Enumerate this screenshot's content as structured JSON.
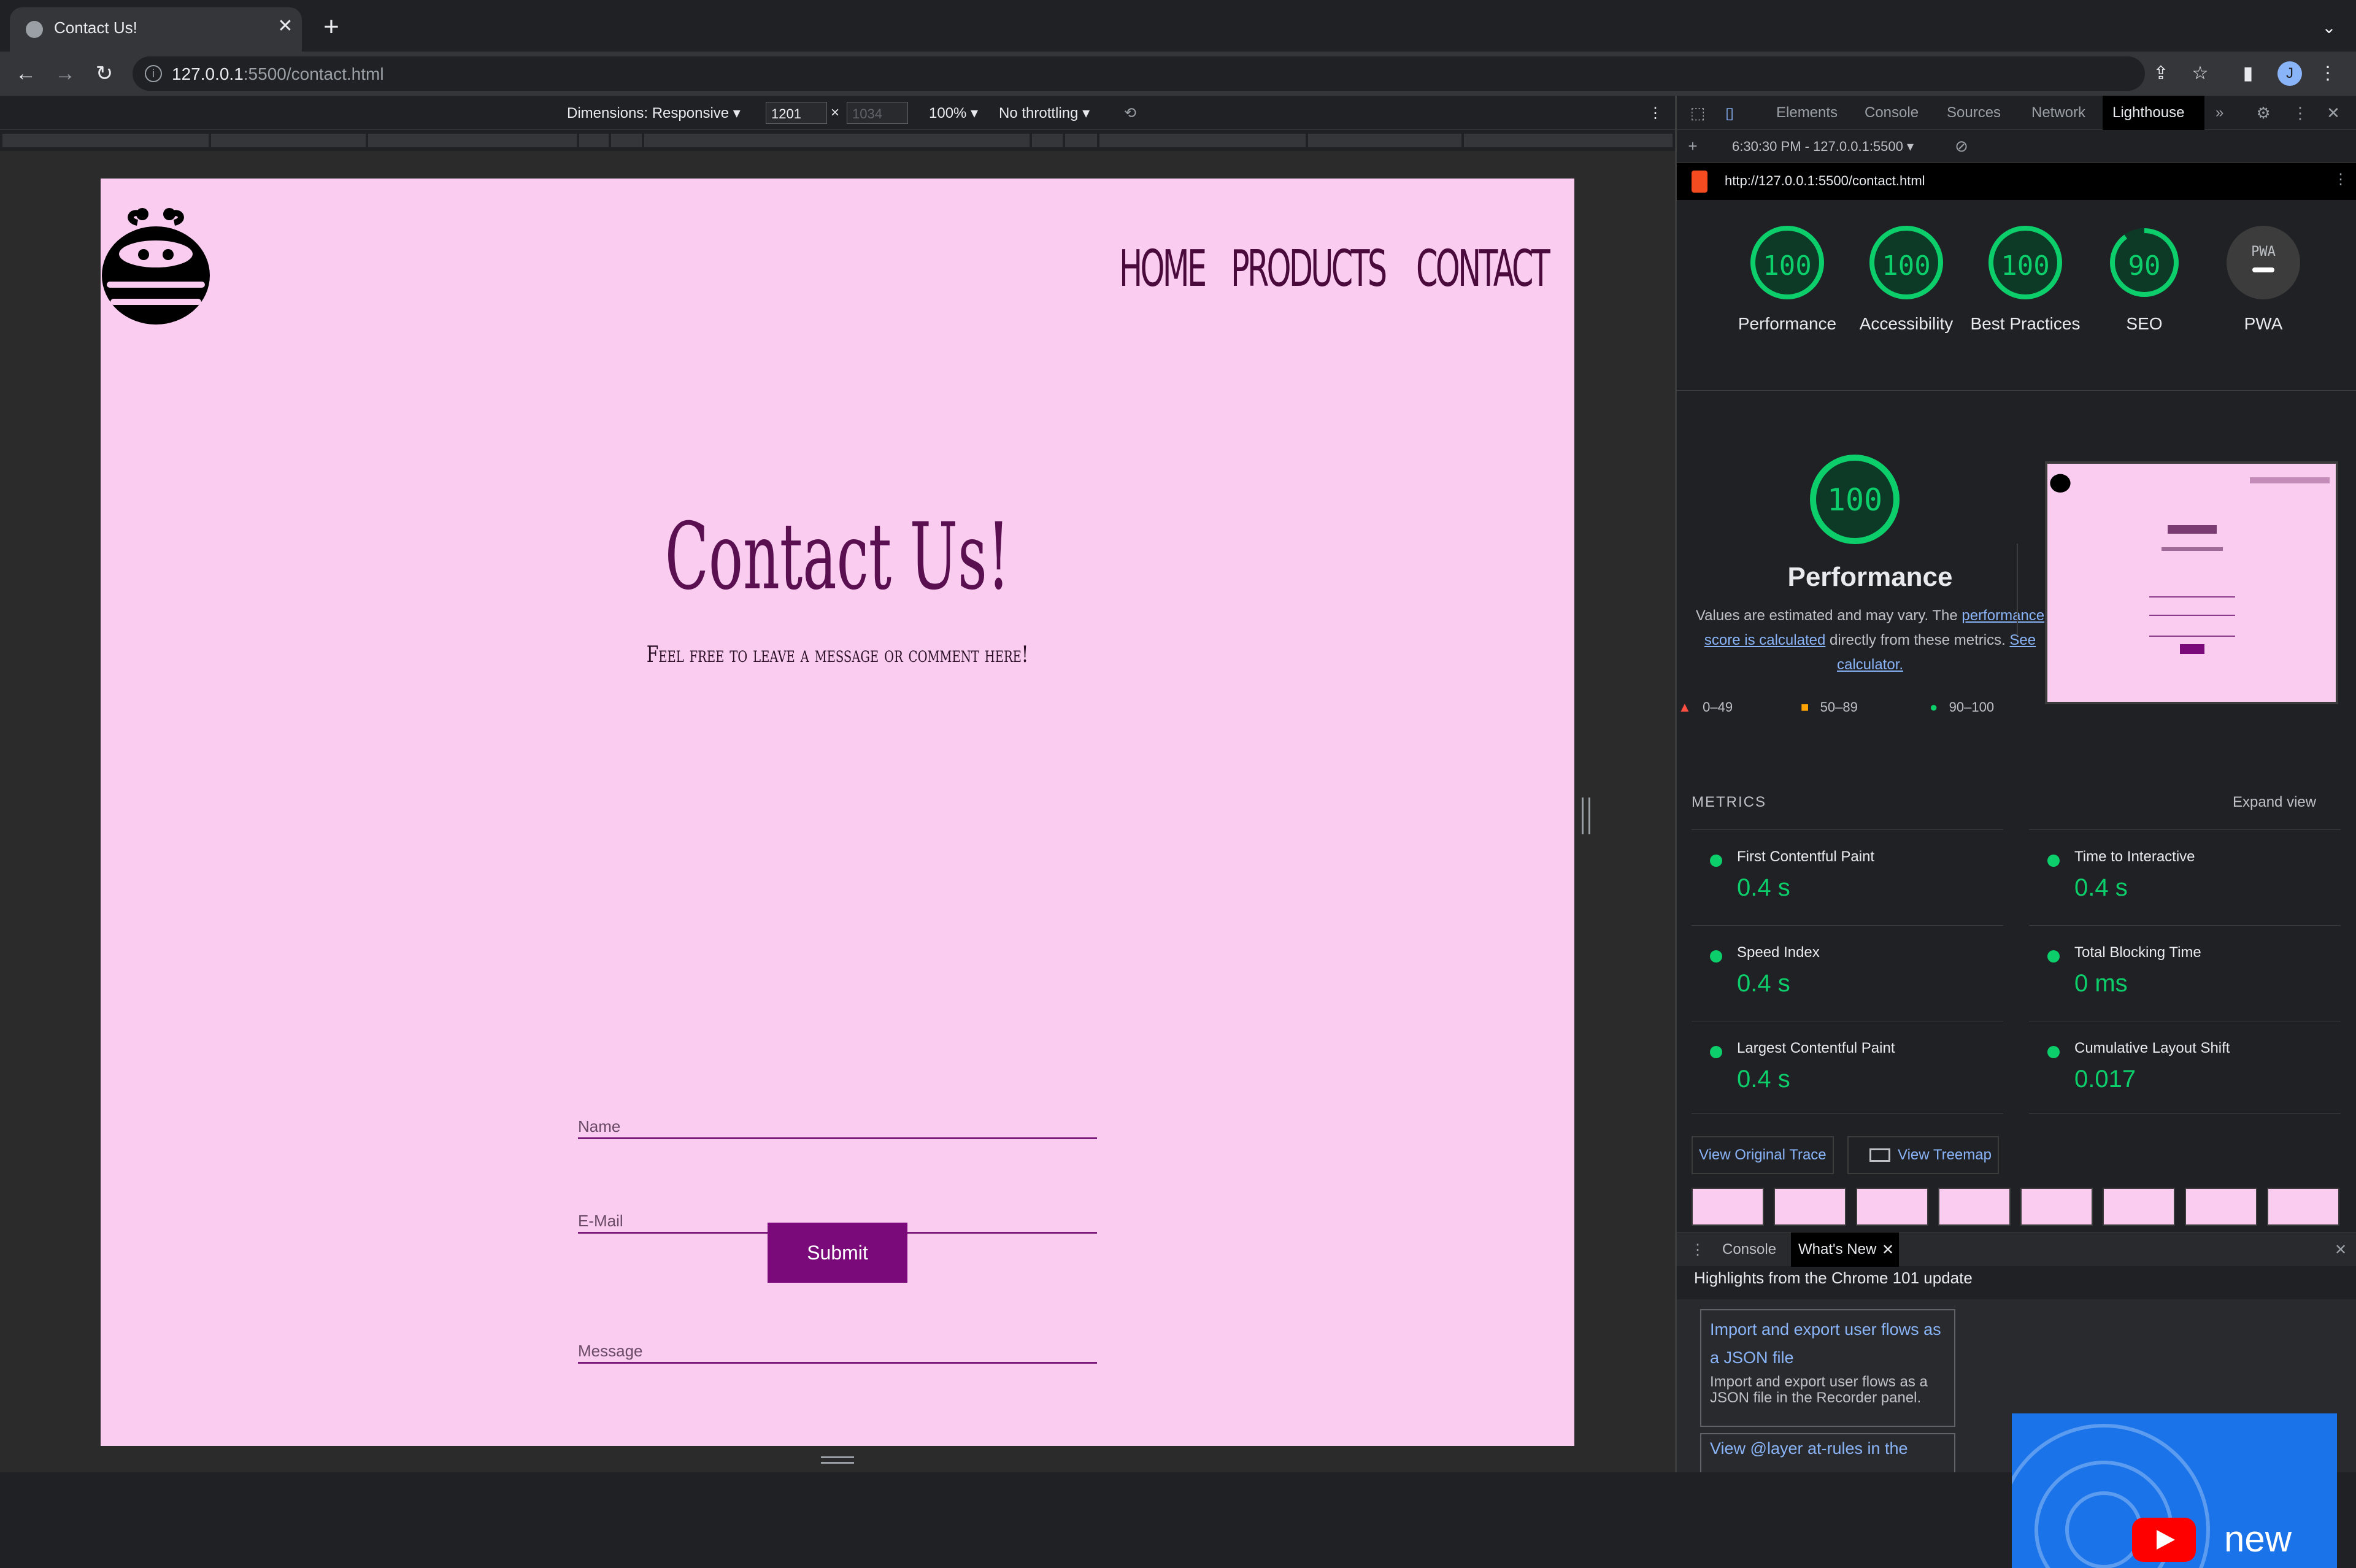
{
  "browser": {
    "tab_title": "Contact Us!",
    "tab_close": "✕",
    "new_tab": "+",
    "tab_search": "⌄",
    "url_host": "127.0.0.1",
    "url_rest": ":5500/contact.html",
    "avatar_letter": "J",
    "icons": [
      "back-icon",
      "forward-icon",
      "reload-icon",
      "info-icon",
      "share-icon",
      "star-icon",
      "sidepanel-icon",
      "profile-avatar",
      "kebab-icon"
    ]
  },
  "device_toolbar": {
    "dimensions": "Dimensions: Responsive ▾",
    "width": "1201",
    "times": "×",
    "height": "1034",
    "zoom": "100% ▾",
    "throttle": "No throttling ▾"
  },
  "site": {
    "nav": [
      "HOME",
      "PRODUCTS",
      "CONTACT"
    ],
    "heading": "Contact Us!",
    "subheading": "Feel free to leave a message or comment here!",
    "fields": {
      "name": "Name",
      "email": "E-Mail",
      "message": "Message"
    },
    "submit": "Submit"
  },
  "devtools": {
    "tabs": [
      "Elements",
      "Console",
      "Sources",
      "Network",
      "Lighthouse"
    ],
    "more": "»",
    "report_select": "6:30:30 PM - 127.0.0.1:5500 ▾",
    "report_url": "http://127.0.0.1:5500/contact.html",
    "scores": [
      {
        "label": "Performance",
        "value": 100
      },
      {
        "label": "Accessibility",
        "value": 100
      },
      {
        "label": "Best Practices",
        "value": 100
      },
      {
        "label": "SEO",
        "value": 90
      },
      {
        "label": "PWA",
        "value": null
      }
    ],
    "pwa_badge": "PWA",
    "perf": {
      "score": "100",
      "title": "Performance",
      "desc_1": "Values are estimated and may vary. The",
      "desc_link": "performance score is calculated",
      "desc_2": "directly from these metrics.",
      "desc_link2": "See calculator."
    },
    "legend": [
      "0–49",
      "50–89",
      "90–100"
    ],
    "metrics_header": "METRICS",
    "expand_view": "Expand view",
    "metrics": [
      {
        "name": "First Contentful Paint",
        "value": "0.4 s"
      },
      {
        "name": "Time to Interactive",
        "value": "0.4 s"
      },
      {
        "name": "Speed Index",
        "value": "0.4 s"
      },
      {
        "name": "Total Blocking Time",
        "value": "0 ms"
      },
      {
        "name": "Largest Contentful Paint",
        "value": "0.4 s"
      },
      {
        "name": "Cumulative Layout Shift",
        "value": "0.017"
      }
    ],
    "view_trace": "View Original Trace",
    "view_treemap": "View Treemap",
    "colors": {
      "pass": "#0cce6b",
      "average": "#ffa400",
      "fail": "#ff4e42"
    }
  },
  "drawer": {
    "tabs": [
      "Console",
      "What's New"
    ],
    "highlights": "Highlights from the Chrome 101 update",
    "card1_title": "Import and export user flows as a JSON file",
    "card1_body": "Import and export user flows as a JSON file in the Recorder panel.",
    "card2_title": "View @layer at-rules in the",
    "video_text": "new"
  }
}
